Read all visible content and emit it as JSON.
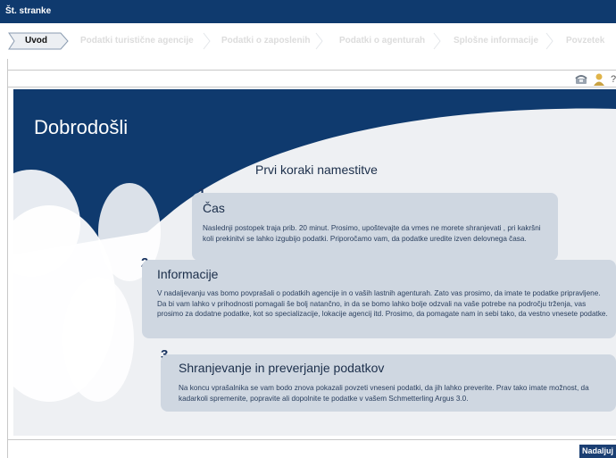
{
  "header": {
    "title": "Št. stranke"
  },
  "steps": [
    {
      "label": "Uvod",
      "active": true
    },
    {
      "label": "Podatki turistične agencije",
      "active": false
    },
    {
      "label": "Podatki o zaposlenih",
      "active": false
    },
    {
      "label": "Podatki o agenturah",
      "active": false
    },
    {
      "label": "Splošne informacije",
      "active": false
    },
    {
      "label": "Povzetek",
      "active": false
    }
  ],
  "icons": [
    "phone-icon",
    "person-icon"
  ],
  "main": {
    "welcome": "Dobrodošli",
    "subtitle": "Prvi koraki namestitve",
    "sections": [
      {
        "number": "1",
        "title": "Čas",
        "text": "Naslednji postopek traja prib. 20 minut. Prosimo, upoštevajte da vmes ne morete shranjevati , pri kakršni koli prekinitvi se lahko izgubijo podatki. Priporočamo vam, da podatke uredite izven delovnega časa."
      },
      {
        "number": "2",
        "title": "Informacije",
        "text": "V nadaljevanju vas bomo povprašali o podatkih agencije in o vaših lastnih agenturah. Zato vas prosimo, da imate te podatke pripravljene. Da bi vam lahko v prihodnosti pomagali še bolj natančno, in da se bomo lahko bolje odzvali na vaše potrebe na področju trženja, vas prosimo za dodatne podatke, kot so specializacije, lokacije agencij itd. Prosimo, da pomagate nam in sebi tako, da vestno vnesete podatke."
      },
      {
        "number": "3",
        "title": "Shranjevanje in preverjanje podatkov",
        "text": "Na koncu vprašalnika se vam bodo znova pokazali povzeti vneseni podatki, da jih lahko preverite. Prav tako imate možnost, da kadarkoli spremenite, popravite ali dopolnite te podatke v vašem Schmetterling Argus 3.0."
      }
    ]
  },
  "footer": {
    "next_label": "Nadaljuj"
  },
  "colors": {
    "navy": "#0f3a6e",
    "card": "#cfd7e1",
    "button": "#1b3f73"
  }
}
